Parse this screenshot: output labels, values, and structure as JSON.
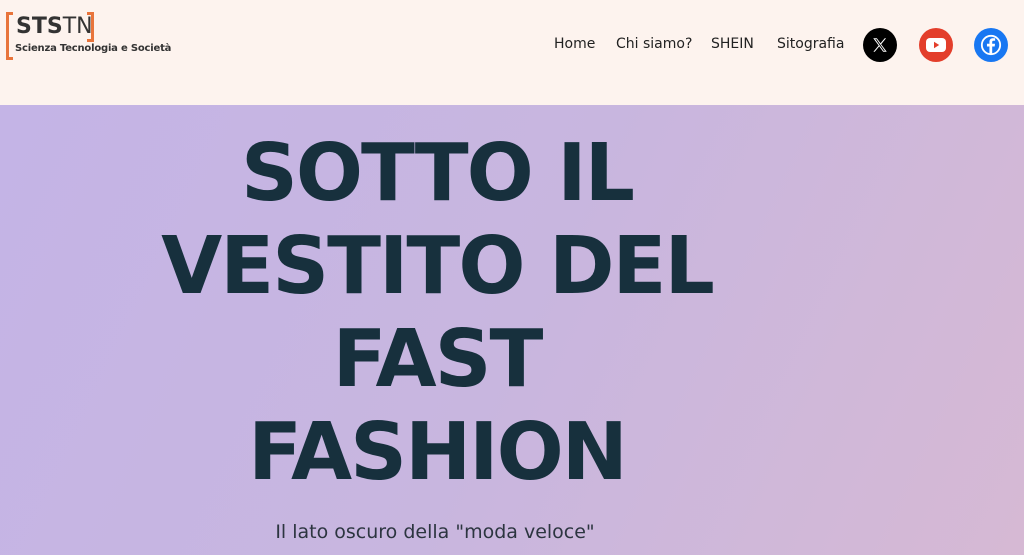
{
  "logo": {
    "mark_bold": "STS",
    "mark_thin": "TN",
    "subtitle": "Scienza Tecnologia e Società"
  },
  "nav": {
    "items": [
      {
        "label": "Home"
      },
      {
        "label": "Chi siamo?"
      },
      {
        "label": "SHEIN"
      },
      {
        "label": "Sitografia"
      }
    ]
  },
  "social": [
    {
      "icon": "x-logo-icon",
      "color": "#000000"
    },
    {
      "icon": "youtube-icon",
      "color": "#e33e2b"
    },
    {
      "icon": "facebook-icon",
      "color": "#1877f2"
    }
  ],
  "hero": {
    "title_lines": [
      "SOTTO IL",
      "VESTITO DEL",
      "FAST",
      "FASHION"
    ],
    "subtitle": "Il lato oscuro della \"moda veloce\""
  }
}
